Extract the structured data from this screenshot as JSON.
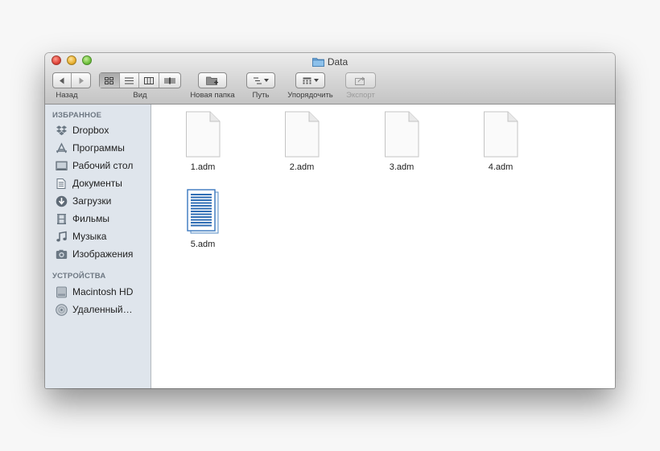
{
  "window": {
    "title": "Data"
  },
  "toolbar": {
    "back_label": "Назад",
    "view_label": "Вид",
    "new_folder_label": "Новая папка",
    "path_label": "Путь",
    "arrange_label": "Упорядочить",
    "export_label": "Экспорт"
  },
  "sidebar": {
    "favorites_header": "ИЗБРАННОЕ",
    "favorites": [
      {
        "label": "Dropbox",
        "icon": "dropbox-icon"
      },
      {
        "label": "Программы",
        "icon": "applications-icon"
      },
      {
        "label": "Рабочий стол",
        "icon": "desktop-icon"
      },
      {
        "label": "Документы",
        "icon": "documents-icon"
      },
      {
        "label": "Загрузки",
        "icon": "downloads-icon"
      },
      {
        "label": "Фильмы",
        "icon": "movies-icon"
      },
      {
        "label": "Музыка",
        "icon": "music-icon"
      },
      {
        "label": "Изображения",
        "icon": "pictures-icon"
      }
    ],
    "devices_header": "УСТРОЙСТВА",
    "devices": [
      {
        "label": "Macintosh HD",
        "icon": "hard-drive-icon"
      },
      {
        "label": "Удаленный…",
        "icon": "remote-disc-icon"
      }
    ]
  },
  "files": [
    {
      "name": "1.adm",
      "icon": "blank-document-icon"
    },
    {
      "name": "2.adm",
      "icon": "blank-document-icon"
    },
    {
      "name": "3.adm",
      "icon": "blank-document-icon"
    },
    {
      "name": "4.adm",
      "icon": "blank-document-icon"
    },
    {
      "name": "5.adm",
      "icon": "text-document-icon"
    }
  ],
  "colors": {
    "sidebar_bg": "#dfe5ec",
    "sidebar_header": "#6d7782",
    "folder_blue": "#6fa8d9"
  }
}
